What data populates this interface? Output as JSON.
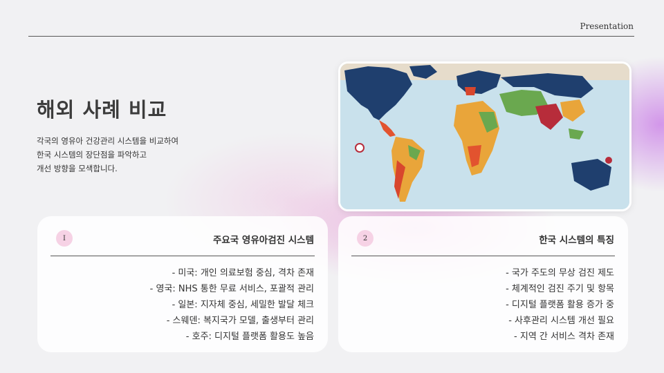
{
  "header": {
    "label": "Presentation"
  },
  "title": "해외 사례 비교",
  "intro": [
    "각국의 영유아 건강관리 시스템을 비교하여",
    "한국 시스템의 장단점을 파악하고",
    "개선 방향을 모색합니다."
  ],
  "map_image": {
    "icon": "world-map-illustration",
    "ocean_color": "#c9e1ec",
    "land_color": "#1f3f6e"
  },
  "cards": [
    {
      "number": "I",
      "title": "주요국 영유아검진 시스템",
      "items": [
        "- 미국: 개인 의료보험 중심, 격차 존재",
        "- 영국: NHS 통한 무료 서비스, 포괄적 관리",
        "- 일본: 지자체 중심, 세밀한 발달 체크",
        "- 스웨덴: 복지국가 모델, 출생부터 관리",
        "- 호주: 디지털 플랫폼 활용도 높음"
      ]
    },
    {
      "number": "2",
      "title": "한국 시스템의 특징",
      "items": [
        "- 국가 주도의 무상 검진 제도",
        "- 체계적인 검진 주기 및 항목",
        "- 디지털 플랫폼 활용 증가 중",
        "- 사후관리 시스템 개선 필요",
        "- 지역 간 서비스 격차 존재"
      ]
    }
  ]
}
